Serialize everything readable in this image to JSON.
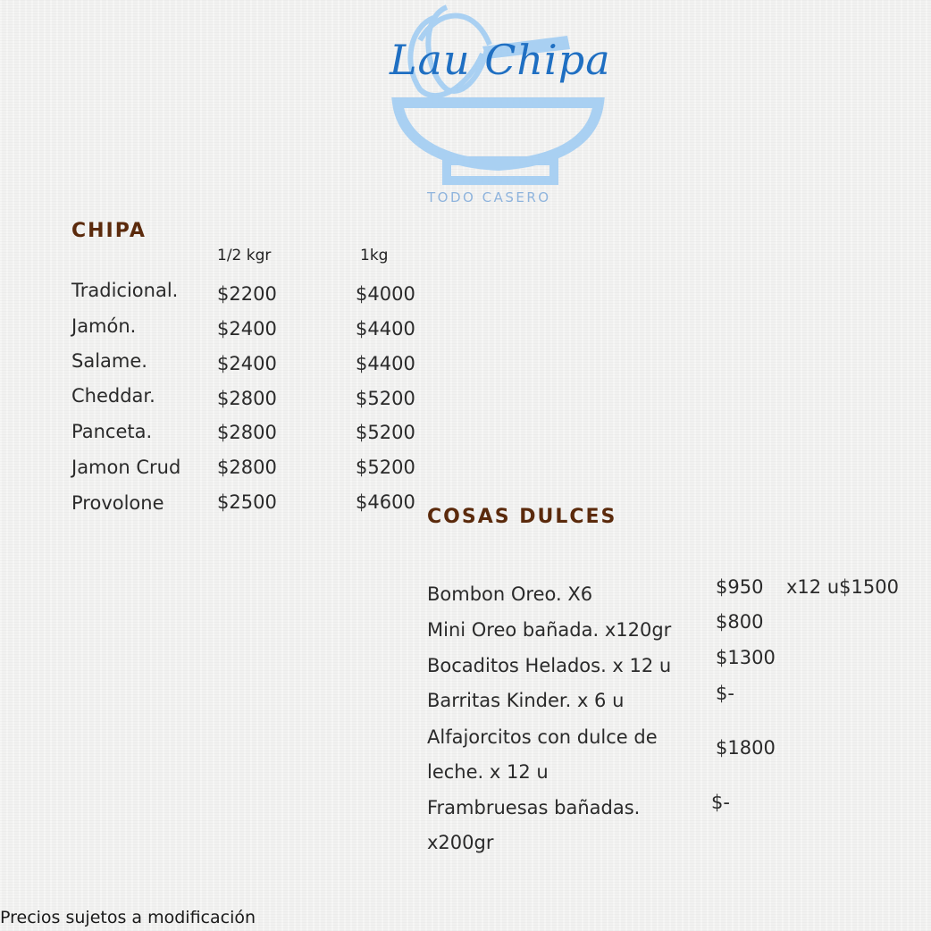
{
  "brand": {
    "name": "Lau Chipa",
    "tagline": "TODO CASERO"
  },
  "chipa": {
    "heading": "CHIPA",
    "col_half": "1/2 kgr",
    "col_kg": "1kg",
    "rows": [
      {
        "name": "Tradicional.",
        "half": "$2200",
        "kg": "$4000"
      },
      {
        "name": "Jamón.",
        "half": "$2400",
        "kg": "$4400"
      },
      {
        "name": "Salame.",
        "half": "$2400",
        "kg": "$4400"
      },
      {
        "name": "Cheddar.",
        "half": "$2800",
        "kg": "$5200"
      },
      {
        "name": "Panceta.",
        "half": "$2800",
        "kg": "$5200"
      },
      {
        "name": "Jamon Crud",
        "half": "$2800",
        "kg": "$5200"
      },
      {
        "name": "Provolone",
        "half": "$2500",
        "kg": "$4600"
      }
    ]
  },
  "dulces": {
    "heading": "COSAS DULCES",
    "items": [
      {
        "name": "Bombon Oreo. X6",
        "price": "$950",
        "extra": "x12 u$1500"
      },
      {
        "name": "Mini Oreo bañada. x120gr",
        "price": "$800"
      },
      {
        "name": "Bocaditos Helados. x 12 u",
        "price": "$1300"
      },
      {
        "name": "Barritas Kinder. x 6 u",
        "price": "$-"
      },
      {
        "name_line1": "Alfajorcitos con dulce de",
        "name_line2": "leche. x 12 u",
        "price": "$1800"
      },
      {
        "name_line1": "Frambruesas bañadas.",
        "name_line2": "x200gr",
        "price": "$-"
      }
    ]
  },
  "footer": {
    "note": "Precios sujetos a modificación"
  },
  "colors": {
    "heading": "#5b2a0c",
    "logo_blue": "#1f6fc2",
    "logo_light": "#a9d0f2"
  }
}
